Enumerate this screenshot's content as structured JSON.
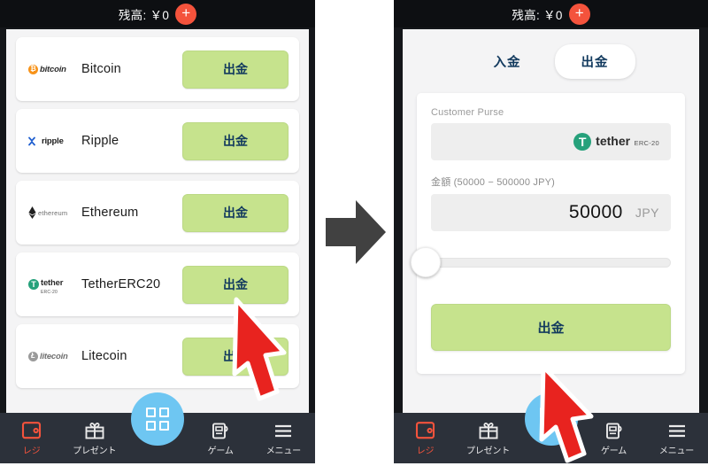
{
  "statusbar": {
    "balance_label": "残高: ￥0",
    "add_icon": "+"
  },
  "left_screen": {
    "coins": [
      {
        "logo_word": "bitcoin",
        "logo_mark": "₿",
        "name": "Bitcoin",
        "action": "出金"
      },
      {
        "logo_word": "ripple",
        "logo_mark": "",
        "name": "Ripple",
        "action": "出金"
      },
      {
        "logo_word": "ethereum",
        "logo_mark": "",
        "name": "Ethereum",
        "action": "出金"
      },
      {
        "logo_word": "tether",
        "logo_mark": "T",
        "logo_sub": "ERC-20",
        "name": "TetherERC20",
        "action": "出金"
      },
      {
        "logo_word": "litecoin",
        "logo_mark": "Ł",
        "name": "Litecoin",
        "action": "出金"
      }
    ]
  },
  "right_screen": {
    "tabs": [
      {
        "label": "入金",
        "active": false
      },
      {
        "label": "出金",
        "active": true
      }
    ],
    "purse": {
      "label": "Customer Purse",
      "value_word": "tether",
      "value_mark": "T",
      "value_sub": "ERC-20"
    },
    "amount": {
      "label": "金額 (50000 − 500000 JPY)",
      "value": "50000",
      "currency": "JPY"
    },
    "slider": {
      "position_percent": 0
    },
    "submit_label": "出金"
  },
  "navbar": {
    "items": [
      {
        "label": "レジ",
        "icon": "wallet-icon",
        "active": true
      },
      {
        "label": "プレゼント",
        "icon": "gift-icon",
        "active": false
      },
      {
        "label": "ゲーム",
        "icon": "game-icon",
        "active": false
      },
      {
        "label": "メニュー",
        "icon": "hamburger-icon",
        "active": false
      }
    ],
    "center_icon": "grid-apps-icon"
  },
  "colors": {
    "accent_red": "#f4533c",
    "button_green": "#c6e38d",
    "button_text": "#123a5e",
    "nav_bg": "#2c313a",
    "center_blue": "#6ec6f2",
    "tether_green": "#26a17b",
    "bitcoin_orange": "#f7931a"
  }
}
